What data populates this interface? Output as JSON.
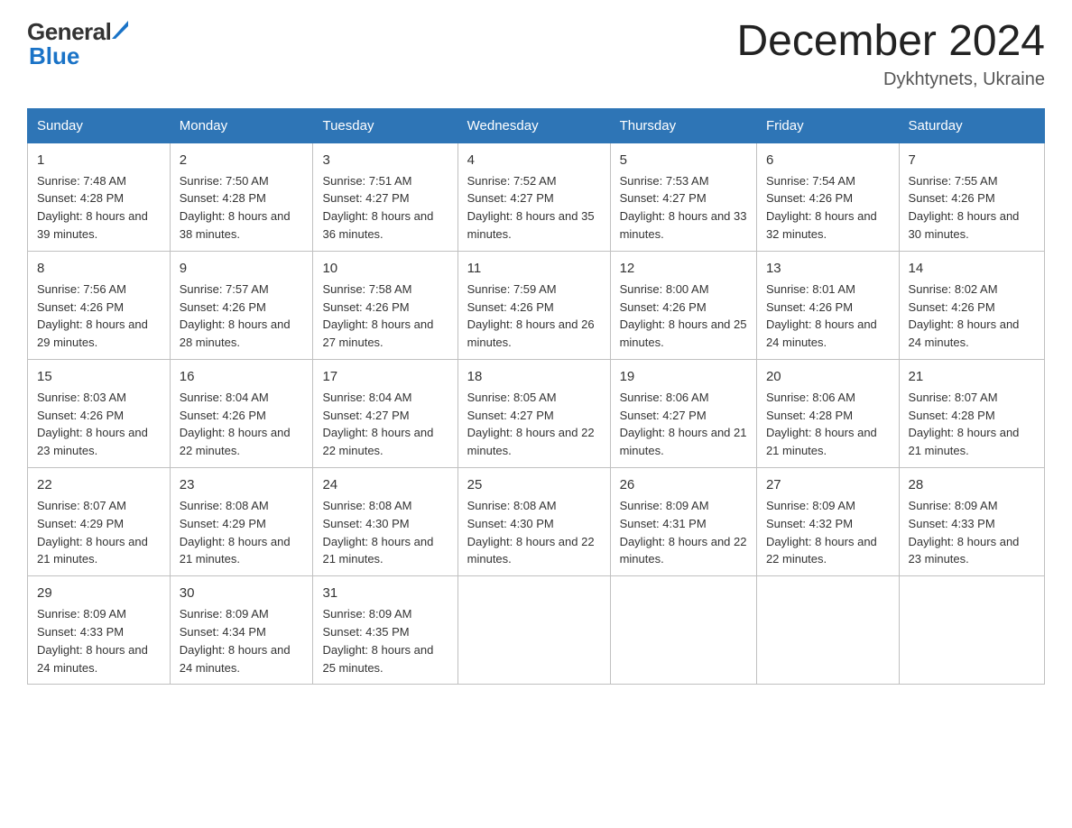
{
  "header": {
    "logo_general": "General",
    "logo_blue": "Blue",
    "main_title": "December 2024",
    "subtitle": "Dykhtynets, Ukraine"
  },
  "calendar": {
    "days_of_week": [
      "Sunday",
      "Monday",
      "Tuesday",
      "Wednesday",
      "Thursday",
      "Friday",
      "Saturday"
    ],
    "weeks": [
      [
        {
          "day": "1",
          "sunrise": "7:48 AM",
          "sunset": "4:28 PM",
          "daylight": "8 hours and 39 minutes."
        },
        {
          "day": "2",
          "sunrise": "7:50 AM",
          "sunset": "4:28 PM",
          "daylight": "8 hours and 38 minutes."
        },
        {
          "day": "3",
          "sunrise": "7:51 AM",
          "sunset": "4:27 PM",
          "daylight": "8 hours and 36 minutes."
        },
        {
          "day": "4",
          "sunrise": "7:52 AM",
          "sunset": "4:27 PM",
          "daylight": "8 hours and 35 minutes."
        },
        {
          "day": "5",
          "sunrise": "7:53 AM",
          "sunset": "4:27 PM",
          "daylight": "8 hours and 33 minutes."
        },
        {
          "day": "6",
          "sunrise": "7:54 AM",
          "sunset": "4:26 PM",
          "daylight": "8 hours and 32 minutes."
        },
        {
          "day": "7",
          "sunrise": "7:55 AM",
          "sunset": "4:26 PM",
          "daylight": "8 hours and 30 minutes."
        }
      ],
      [
        {
          "day": "8",
          "sunrise": "7:56 AM",
          "sunset": "4:26 PM",
          "daylight": "8 hours and 29 minutes."
        },
        {
          "day": "9",
          "sunrise": "7:57 AM",
          "sunset": "4:26 PM",
          "daylight": "8 hours and 28 minutes."
        },
        {
          "day": "10",
          "sunrise": "7:58 AM",
          "sunset": "4:26 PM",
          "daylight": "8 hours and 27 minutes."
        },
        {
          "day": "11",
          "sunrise": "7:59 AM",
          "sunset": "4:26 PM",
          "daylight": "8 hours and 26 minutes."
        },
        {
          "day": "12",
          "sunrise": "8:00 AM",
          "sunset": "4:26 PM",
          "daylight": "8 hours and 25 minutes."
        },
        {
          "day": "13",
          "sunrise": "8:01 AM",
          "sunset": "4:26 PM",
          "daylight": "8 hours and 24 minutes."
        },
        {
          "day": "14",
          "sunrise": "8:02 AM",
          "sunset": "4:26 PM",
          "daylight": "8 hours and 24 minutes."
        }
      ],
      [
        {
          "day": "15",
          "sunrise": "8:03 AM",
          "sunset": "4:26 PM",
          "daylight": "8 hours and 23 minutes."
        },
        {
          "day": "16",
          "sunrise": "8:04 AM",
          "sunset": "4:26 PM",
          "daylight": "8 hours and 22 minutes."
        },
        {
          "day": "17",
          "sunrise": "8:04 AM",
          "sunset": "4:27 PM",
          "daylight": "8 hours and 22 minutes."
        },
        {
          "day": "18",
          "sunrise": "8:05 AM",
          "sunset": "4:27 PM",
          "daylight": "8 hours and 22 minutes."
        },
        {
          "day": "19",
          "sunrise": "8:06 AM",
          "sunset": "4:27 PM",
          "daylight": "8 hours and 21 minutes."
        },
        {
          "day": "20",
          "sunrise": "8:06 AM",
          "sunset": "4:28 PM",
          "daylight": "8 hours and 21 minutes."
        },
        {
          "day": "21",
          "sunrise": "8:07 AM",
          "sunset": "4:28 PM",
          "daylight": "8 hours and 21 minutes."
        }
      ],
      [
        {
          "day": "22",
          "sunrise": "8:07 AM",
          "sunset": "4:29 PM",
          "daylight": "8 hours and 21 minutes."
        },
        {
          "day": "23",
          "sunrise": "8:08 AM",
          "sunset": "4:29 PM",
          "daylight": "8 hours and 21 minutes."
        },
        {
          "day": "24",
          "sunrise": "8:08 AM",
          "sunset": "4:30 PM",
          "daylight": "8 hours and 21 minutes."
        },
        {
          "day": "25",
          "sunrise": "8:08 AM",
          "sunset": "4:30 PM",
          "daylight": "8 hours and 22 minutes."
        },
        {
          "day": "26",
          "sunrise": "8:09 AM",
          "sunset": "4:31 PM",
          "daylight": "8 hours and 22 minutes."
        },
        {
          "day": "27",
          "sunrise": "8:09 AM",
          "sunset": "4:32 PM",
          "daylight": "8 hours and 22 minutes."
        },
        {
          "day": "28",
          "sunrise": "8:09 AM",
          "sunset": "4:33 PM",
          "daylight": "8 hours and 23 minutes."
        }
      ],
      [
        {
          "day": "29",
          "sunrise": "8:09 AM",
          "sunset": "4:33 PM",
          "daylight": "8 hours and 24 minutes."
        },
        {
          "day": "30",
          "sunrise": "8:09 AM",
          "sunset": "4:34 PM",
          "daylight": "8 hours and 24 minutes."
        },
        {
          "day": "31",
          "sunrise": "8:09 AM",
          "sunset": "4:35 PM",
          "daylight": "8 hours and 25 minutes."
        },
        null,
        null,
        null,
        null
      ]
    ],
    "labels": {
      "sunrise": "Sunrise:",
      "sunset": "Sunset:",
      "daylight": "Daylight:"
    }
  }
}
